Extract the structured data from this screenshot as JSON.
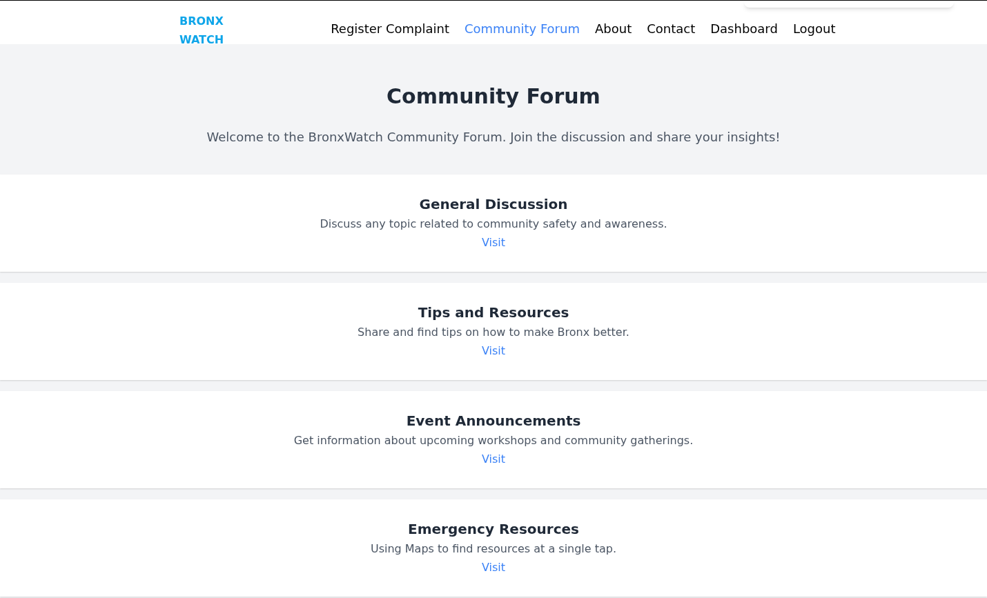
{
  "logo": [
    "BRONX",
    "WATCH"
  ],
  "nav": [
    {
      "label": "Register Complaint",
      "selected": false
    },
    {
      "label": "Community Forum",
      "selected": true
    },
    {
      "label": "About",
      "selected": false
    },
    {
      "label": "Contact",
      "selected": false
    },
    {
      "label": "Dashboard",
      "selected": false
    },
    {
      "label": "Logout",
      "selected": false
    }
  ],
  "hero": {
    "title": "Community Forum",
    "subtitle": "Welcome to the BronxWatch Community Forum. Join the discussion and share your insights!"
  },
  "forums": [
    {
      "title": "General Discussion",
      "description": "Discuss any topic related to community safety and awareness.",
      "link": "Visit"
    },
    {
      "title": "Tips and Resources",
      "description": "Share and find tips on how to make Bronx better.",
      "link": "Visit"
    },
    {
      "title": "Event Announcements",
      "description": "Get information about upcoming workshops and community gatherings.",
      "link": "Visit"
    },
    {
      "title": "Emergency Resources",
      "description": "Using Maps to find resources at a single tap.",
      "link": "Visit"
    }
  ]
}
